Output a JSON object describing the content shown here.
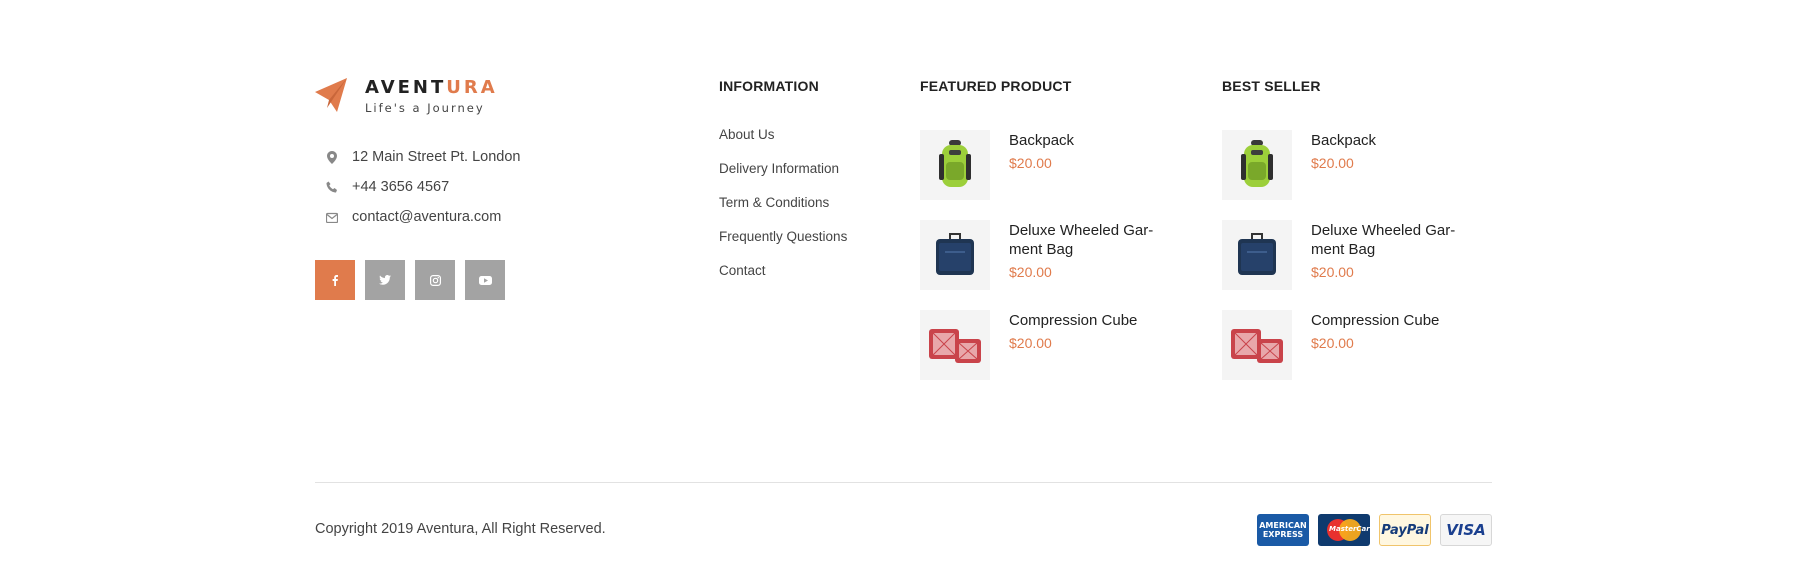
{
  "brand": {
    "name_main": "AVENT",
    "name_accent": "URA",
    "tagline": "Life's a Journey",
    "accent_color": "#e07b4c",
    "logo_icon": "paper-plane-icon"
  },
  "contact": {
    "address": "12 Main Street Pt. London",
    "phone": "+44 3656 4567",
    "email": "contact@aventura.com",
    "icons": [
      "map-pin-icon",
      "phone-icon",
      "envelope-icon"
    ]
  },
  "socials": [
    {
      "icon": "facebook-icon",
      "active": true
    },
    {
      "icon": "twitter-icon",
      "active": false
    },
    {
      "icon": "instagram-icon",
      "active": false
    },
    {
      "icon": "youtube-icon",
      "active": false
    }
  ],
  "information": {
    "heading": "INFORMATION",
    "links": [
      "About Us",
      "Delivery Information",
      "Term & Conditions",
      "Frequently Questions",
      "Contact"
    ]
  },
  "featured": {
    "heading": "FEATURED PRODUCT",
    "products": [
      {
        "name": "Backpack",
        "price": "$20.00",
        "image": "backpack"
      },
      {
        "name": "Deluxe Wheeled Gar-ment Bag",
        "price": "$20.00",
        "image": "garment-bag"
      },
      {
        "name": "Compression Cube",
        "price": "$20.00",
        "image": "compression-cube"
      }
    ]
  },
  "bestseller": {
    "heading": "BEST SELLER",
    "products": [
      {
        "name": "Backpack",
        "price": "$20.00",
        "image": "backpack"
      },
      {
        "name": "Deluxe Wheeled Gar-ment Bag",
        "price": "$20.00",
        "image": "garment-bag"
      },
      {
        "name": "Compression Cube",
        "price": "$20.00",
        "image": "compression-cube"
      }
    ]
  },
  "bottom": {
    "copyright": "Copyright 2019 Aventura, All Right Reserved.",
    "payments": [
      "AMERICAN EXPRESS",
      "MasterCard",
      "PayPal",
      "VISA"
    ]
  }
}
